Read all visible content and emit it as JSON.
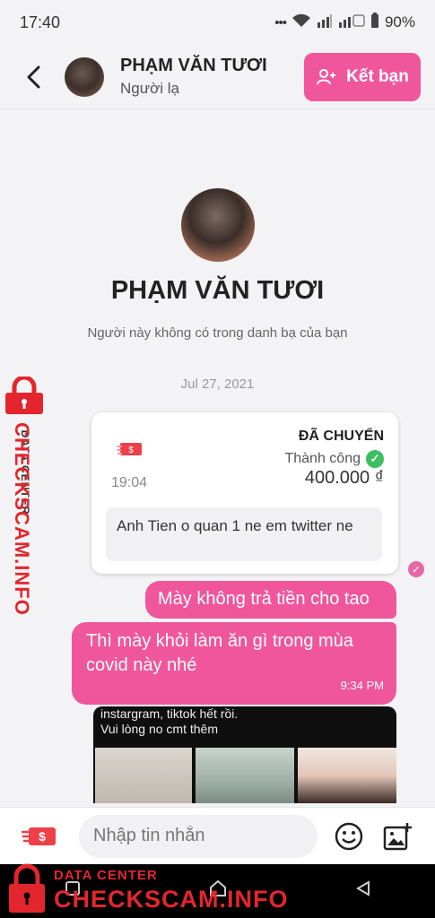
{
  "status_bar": {
    "time": "17:40",
    "battery": "90%"
  },
  "header": {
    "contact_name": "PHẠM VĂN TƯƠI",
    "contact_status": "Người lạ",
    "add_friend_label": "Kết bạn"
  },
  "profile": {
    "name": "PHẠM VĂN TƯƠI",
    "note": "Người này không có trong danh bạ của bạn"
  },
  "date_separator": "Jul 27, 2021",
  "transfer_card": {
    "title": "ĐÃ CHUYỂN",
    "status": "Thành công",
    "amount": "400.000 ₫",
    "time": "19:04",
    "note": "Anh Tien o quan 1 ne em twitter ne"
  },
  "messages": [
    {
      "text": "Mày không trả tiền cho tao"
    },
    {
      "text": "Thì mày khỏi làm ăn gì trong mùa covid này nhé",
      "time": "9:34 PM"
    }
  ],
  "image_message": {
    "caption": "instargram, tiktok hết rồi.\nVui lòng no cmt thêm"
  },
  "composer": {
    "placeholder": "Nhập tin nhắn"
  },
  "watermark": {
    "small": "DATA CENTER",
    "big": "CHECKSCAM.INFO",
    "side_small": "DATA CENTER",
    "side_big": "CHECKSCAM.INFO"
  },
  "colors": {
    "accent": "#f0569c",
    "watermark_red": "#e3262d",
    "success_green": "#3cbf5e"
  },
  "icons": [
    "back-arrow-icon",
    "add-friend-icon",
    "money-transfer-icon",
    "check-circle-icon",
    "seen-check-icon",
    "emoji-icon",
    "image-add-icon",
    "recent-apps-icon",
    "home-icon",
    "back-nav-icon",
    "lock-icon"
  ]
}
